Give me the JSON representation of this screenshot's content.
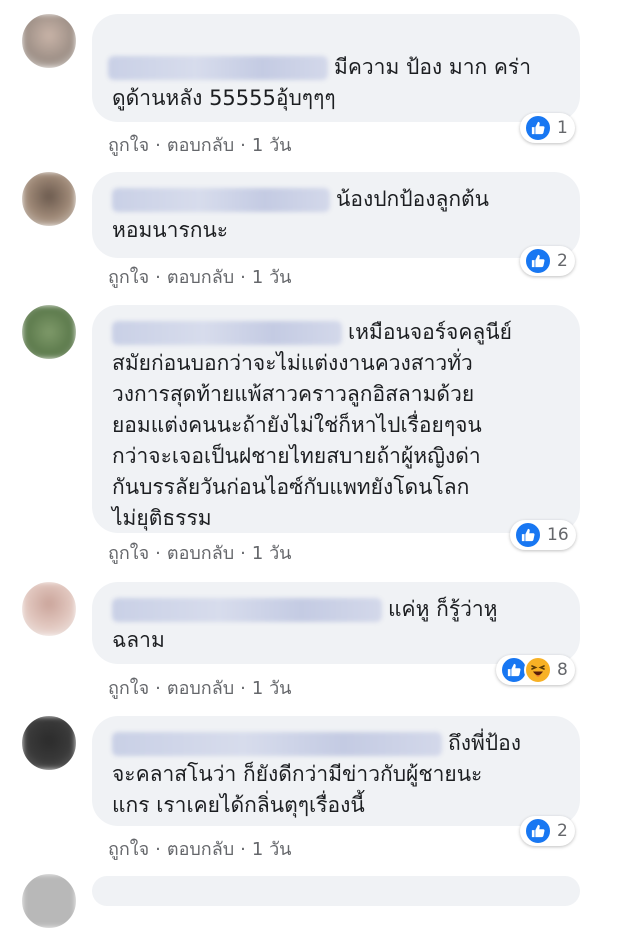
{
  "comments": [
    {
      "lines": [
        "มีความ ป้อง มาก คร่า",
        "ดูด้านหลัง 55555อุ้บๆๆๆ"
      ],
      "like": "ถูกใจ",
      "reply": "ตอบกลับ",
      "time": "1 วัน",
      "reactions": [
        "like"
      ],
      "count": "1"
    },
    {
      "lines": [
        "น้องปกป้องลูกต้น",
        "หอมนารกนะ"
      ],
      "like": "ถูกใจ",
      "reply": "ตอบกลับ",
      "time": "1 วัน",
      "reactions": [
        "like"
      ],
      "count": "2"
    },
    {
      "lines": [
        "เหมือนจอร์จคลูนีย์",
        "สมัยก่อนบอกว่าจะไม่แต่งงานควงสาวทั่ว",
        "วงการสุดท้ายแพ้สาวคราวลูกอิสลามด้วย",
        "ยอมแต่งคนนะถ้ายังไม่ใช่ก็หาไปเรื่อยๆจน",
        "กว่าจะเจอเป็นฝชายไทยสบายถ้าผู้หญิงด่า",
        "กันบรรลัยวันก่อนไอซ์กับแพทยังโดนโลก",
        "ไม่ยุติธรรม"
      ],
      "like": "ถูกใจ",
      "reply": "ตอบกลับ",
      "time": "1 วัน",
      "reactions": [
        "like"
      ],
      "count": "16"
    },
    {
      "lines": [
        "แค่หู ก็รู้ว่าหู",
        "ฉลาม"
      ],
      "like": "ถูกใจ",
      "reply": "ตอบกลับ",
      "time": "1 วัน",
      "reactions": [
        "like",
        "haha"
      ],
      "count": "8"
    },
    {
      "lines": [
        "ถึงพี่ป้อง",
        "จะคลาสโนว่า ก็ยังดีกว่ามีข่าวกับผู้ชายนะ",
        "แกร เราเคยได้กลิ่นตุๆเรื่องนี้"
      ],
      "like": "ถูกใจ",
      "reply": "ตอบกลับ",
      "time": "1 วัน",
      "reactions": [
        "like"
      ],
      "count": "2"
    }
  ],
  "colors": {
    "like_blue": "#1877f2",
    "haha_yellow": "#f7b125",
    "bubble": "#f0f2f5",
    "meta": "#65676b"
  }
}
